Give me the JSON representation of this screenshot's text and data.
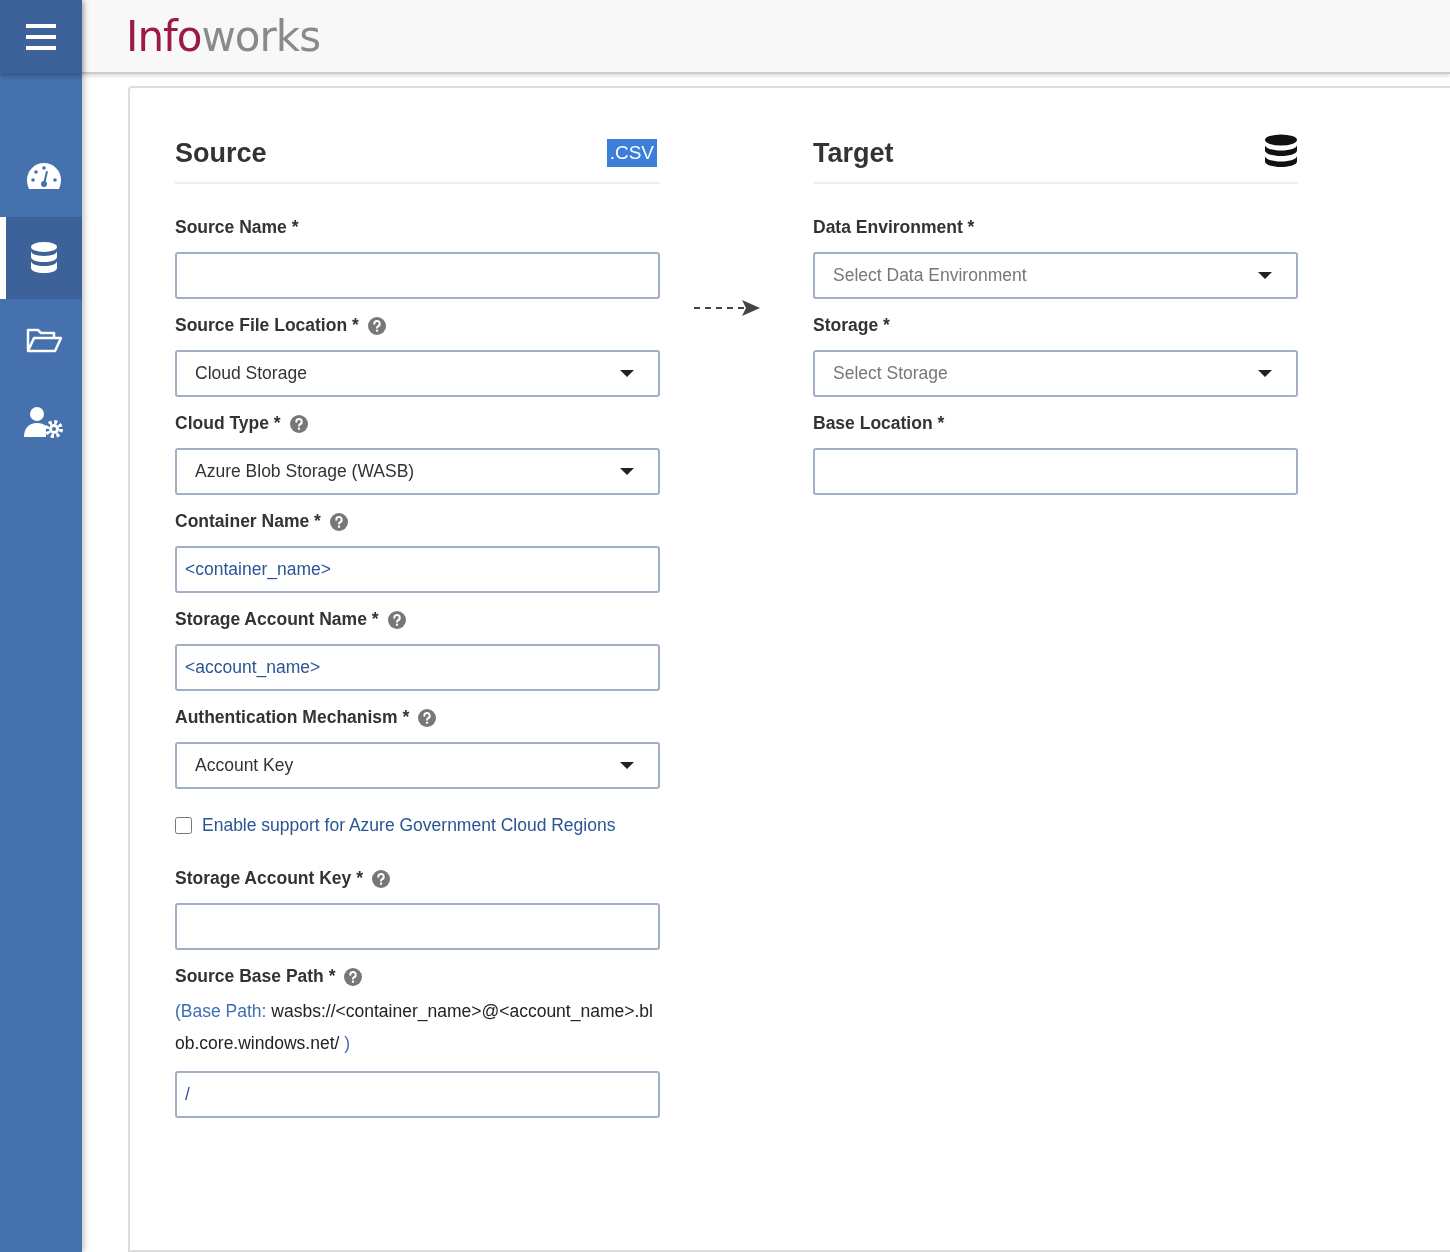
{
  "header": {
    "logo": [
      "Info",
      "works"
    ]
  },
  "sidebar": {
    "items": [
      {
        "kind": "dashboard",
        "selected": false
      },
      {
        "kind": "database",
        "selected": true
      },
      {
        "kind": "folder",
        "selected": false
      },
      {
        "kind": "user-settings",
        "selected": false
      }
    ]
  },
  "source": {
    "title": "Source",
    "badge": ".CSV",
    "fields": [
      {
        "kind": "text",
        "label": "Source Name *",
        "help": false
      },
      {
        "kind": "select",
        "label": "Source File Location *",
        "help": true,
        "value": "Cloud Storage"
      },
      {
        "kind": "select",
        "label": "Cloud Type *",
        "help": true,
        "value": "Azure Blob Storage (WASB)"
      },
      {
        "kind": "text",
        "label": "Container Name *",
        "help": true,
        "value": "<container_name>"
      },
      {
        "kind": "text",
        "label": "Storage Account Name *",
        "help": true,
        "value": "<account_name>"
      },
      {
        "kind": "select",
        "label": "Authentication Mechanism *",
        "help": true,
        "value": "Account Key"
      },
      {
        "kind": "checkbox",
        "label": "Enable support for Azure Government Cloud Regions",
        "checked": false
      },
      {
        "kind": "text",
        "label": "Storage Account Key *",
        "help": true
      },
      {
        "kind": "text",
        "label": "Source Base Path *",
        "help": true,
        "hint": {
          "prefix": "(Base Path: ",
          "path": "wasbs://<container_name>@<account_name>.blob.core.windows.net/",
          "suffix": " )"
        },
        "value": "/"
      }
    ]
  },
  "target": {
    "title": "Target",
    "fields": [
      {
        "kind": "select",
        "label": "Data Environment *",
        "help": false,
        "placeholder": "Select Data Environment"
      },
      {
        "kind": "select",
        "label": "Storage *",
        "help": false,
        "placeholder": "Select Storage"
      },
      {
        "kind": "text",
        "label": "Base Location *",
        "help": false
      }
    ]
  }
}
